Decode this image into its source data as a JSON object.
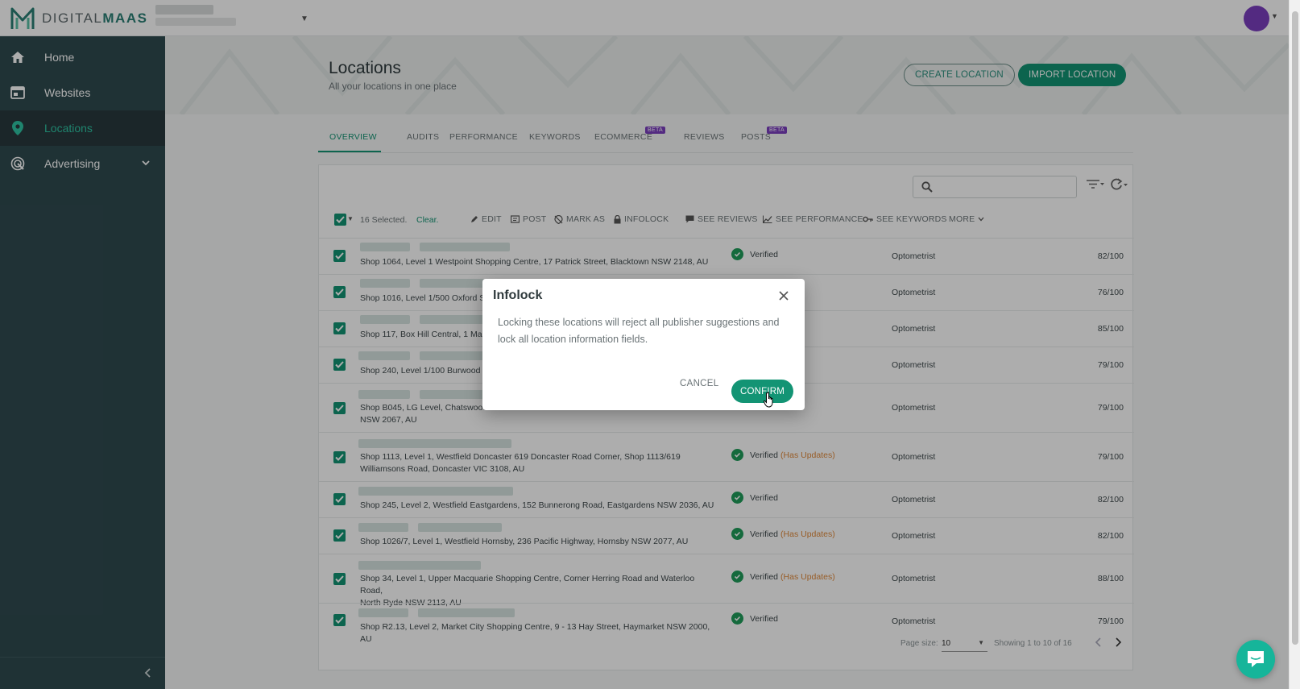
{
  "app": {
    "brand_light": "DIGITAL",
    "brand_bold": "MAAS"
  },
  "sidebar": {
    "items": [
      {
        "label": "Home",
        "icon": "home-icon"
      },
      {
        "label": "Websites",
        "icon": "websites-icon"
      },
      {
        "label": "Locations",
        "icon": "location-pin-icon",
        "active": true
      },
      {
        "label": "Advertising",
        "icon": "advertising-icon",
        "expandable": true
      }
    ]
  },
  "header": {
    "title": "Locations",
    "subtitle": "All your locations in one place",
    "create_button": "CREATE LOCATION",
    "import_button": "IMPORT LOCATION"
  },
  "tabs": [
    {
      "label": "OVERVIEW",
      "active": true
    },
    {
      "label": "AUDITS"
    },
    {
      "label": "PERFORMANCE"
    },
    {
      "label": "KEYWORDS"
    },
    {
      "label": "ECOMMERCE",
      "badge": "BETA"
    },
    {
      "label": "REVIEWS"
    },
    {
      "label": "POSTS",
      "badge": "BETA"
    }
  ],
  "bulk": {
    "selected_text": "16 Selected.",
    "clear": "Clear.",
    "actions": [
      "EDIT",
      "POST",
      "MARK AS",
      "INFOLOCK",
      "SEE REVIEWS",
      "SEE PERFORMANCE",
      "SEE KEYWORDS",
      "MORE"
    ]
  },
  "rows": [
    {
      "address": "Shop 1064, Level 1 Westpoint Shopping Centre, 17 Patrick Street, Blacktown NSW 2148, AU",
      "status": "Verified",
      "updates": "",
      "category": "Optometrist",
      "score": "82/100"
    },
    {
      "address": "Shop 1016, Level 1/500 Oxford S",
      "status": "",
      "updates": "",
      "category": "Optometrist",
      "score": "76/100"
    },
    {
      "address": "Shop 117, Box Hill Central, 1 Ma",
      "status": "",
      "updates": "",
      "category": "Optometrist",
      "score": "85/100"
    },
    {
      "address": "Shop 240, Level 1/100 Burwood",
      "status": "",
      "updates": "",
      "category": "Optometrist",
      "score": "79/100"
    },
    {
      "address": "Shop B045, LG Level, Chatswood",
      "address2": "NSW 2067, AU",
      "status": "",
      "updates": "",
      "category": "Optometrist",
      "score": "79/100"
    },
    {
      "address": "Shop 1113, Level 1, Westfield Doncaster 619 Doncaster Road Corner, Shop 1113/619",
      "address2": "Williamsons Road, Doncaster VIC 3108, AU",
      "status": "Verified",
      "updates": "(Has Updates)",
      "category": "Optometrist",
      "score": "79/100"
    },
    {
      "address": "Shop 245, Level 2, Westfield Eastgardens, 152 Bunnerong Road, Eastgardens NSW 2036, AU",
      "status": "Verified",
      "updates": "",
      "category": "Optometrist",
      "score": "82/100"
    },
    {
      "address": "Shop 1026/7, Level 1, Westfield Hornsby, 236 Pacific Highway, Hornsby NSW 2077, AU",
      "status": "Verified",
      "updates": "(Has Updates)",
      "category": "Optometrist",
      "score": "82/100"
    },
    {
      "address": "Shop 34, Level 1, Upper Macquarie Shopping Centre, Corner Herring Road and Waterloo Road,",
      "address2": "North Ryde NSW 2113, AU",
      "status": "Verified",
      "updates": "(Has Updates)",
      "category": "Optometrist",
      "score": "88/100"
    },
    {
      "address": "Shop R2.13, Level 2, Market City Shopping Centre, 9 - 13 Hay Street, Haymarket NSW 2000, AU",
      "status": "Verified",
      "updates": "",
      "category": "Optometrist",
      "score": "79/100"
    }
  ],
  "pager": {
    "label": "Page size:",
    "size": "10",
    "info": "Showing 1 to 10 of 16"
  },
  "modal": {
    "title": "Infolock",
    "body": "Locking these locations will reject all publisher suggestions and lock all location information fields.",
    "cancel": "CANCEL",
    "confirm": "CONFIRM"
  },
  "colors": {
    "brand": "#139474",
    "sidebar": "#2f4a4f",
    "active_nav": "#2fc3a3",
    "beta": "#7b3fbf",
    "updates": "#e08a3c"
  }
}
